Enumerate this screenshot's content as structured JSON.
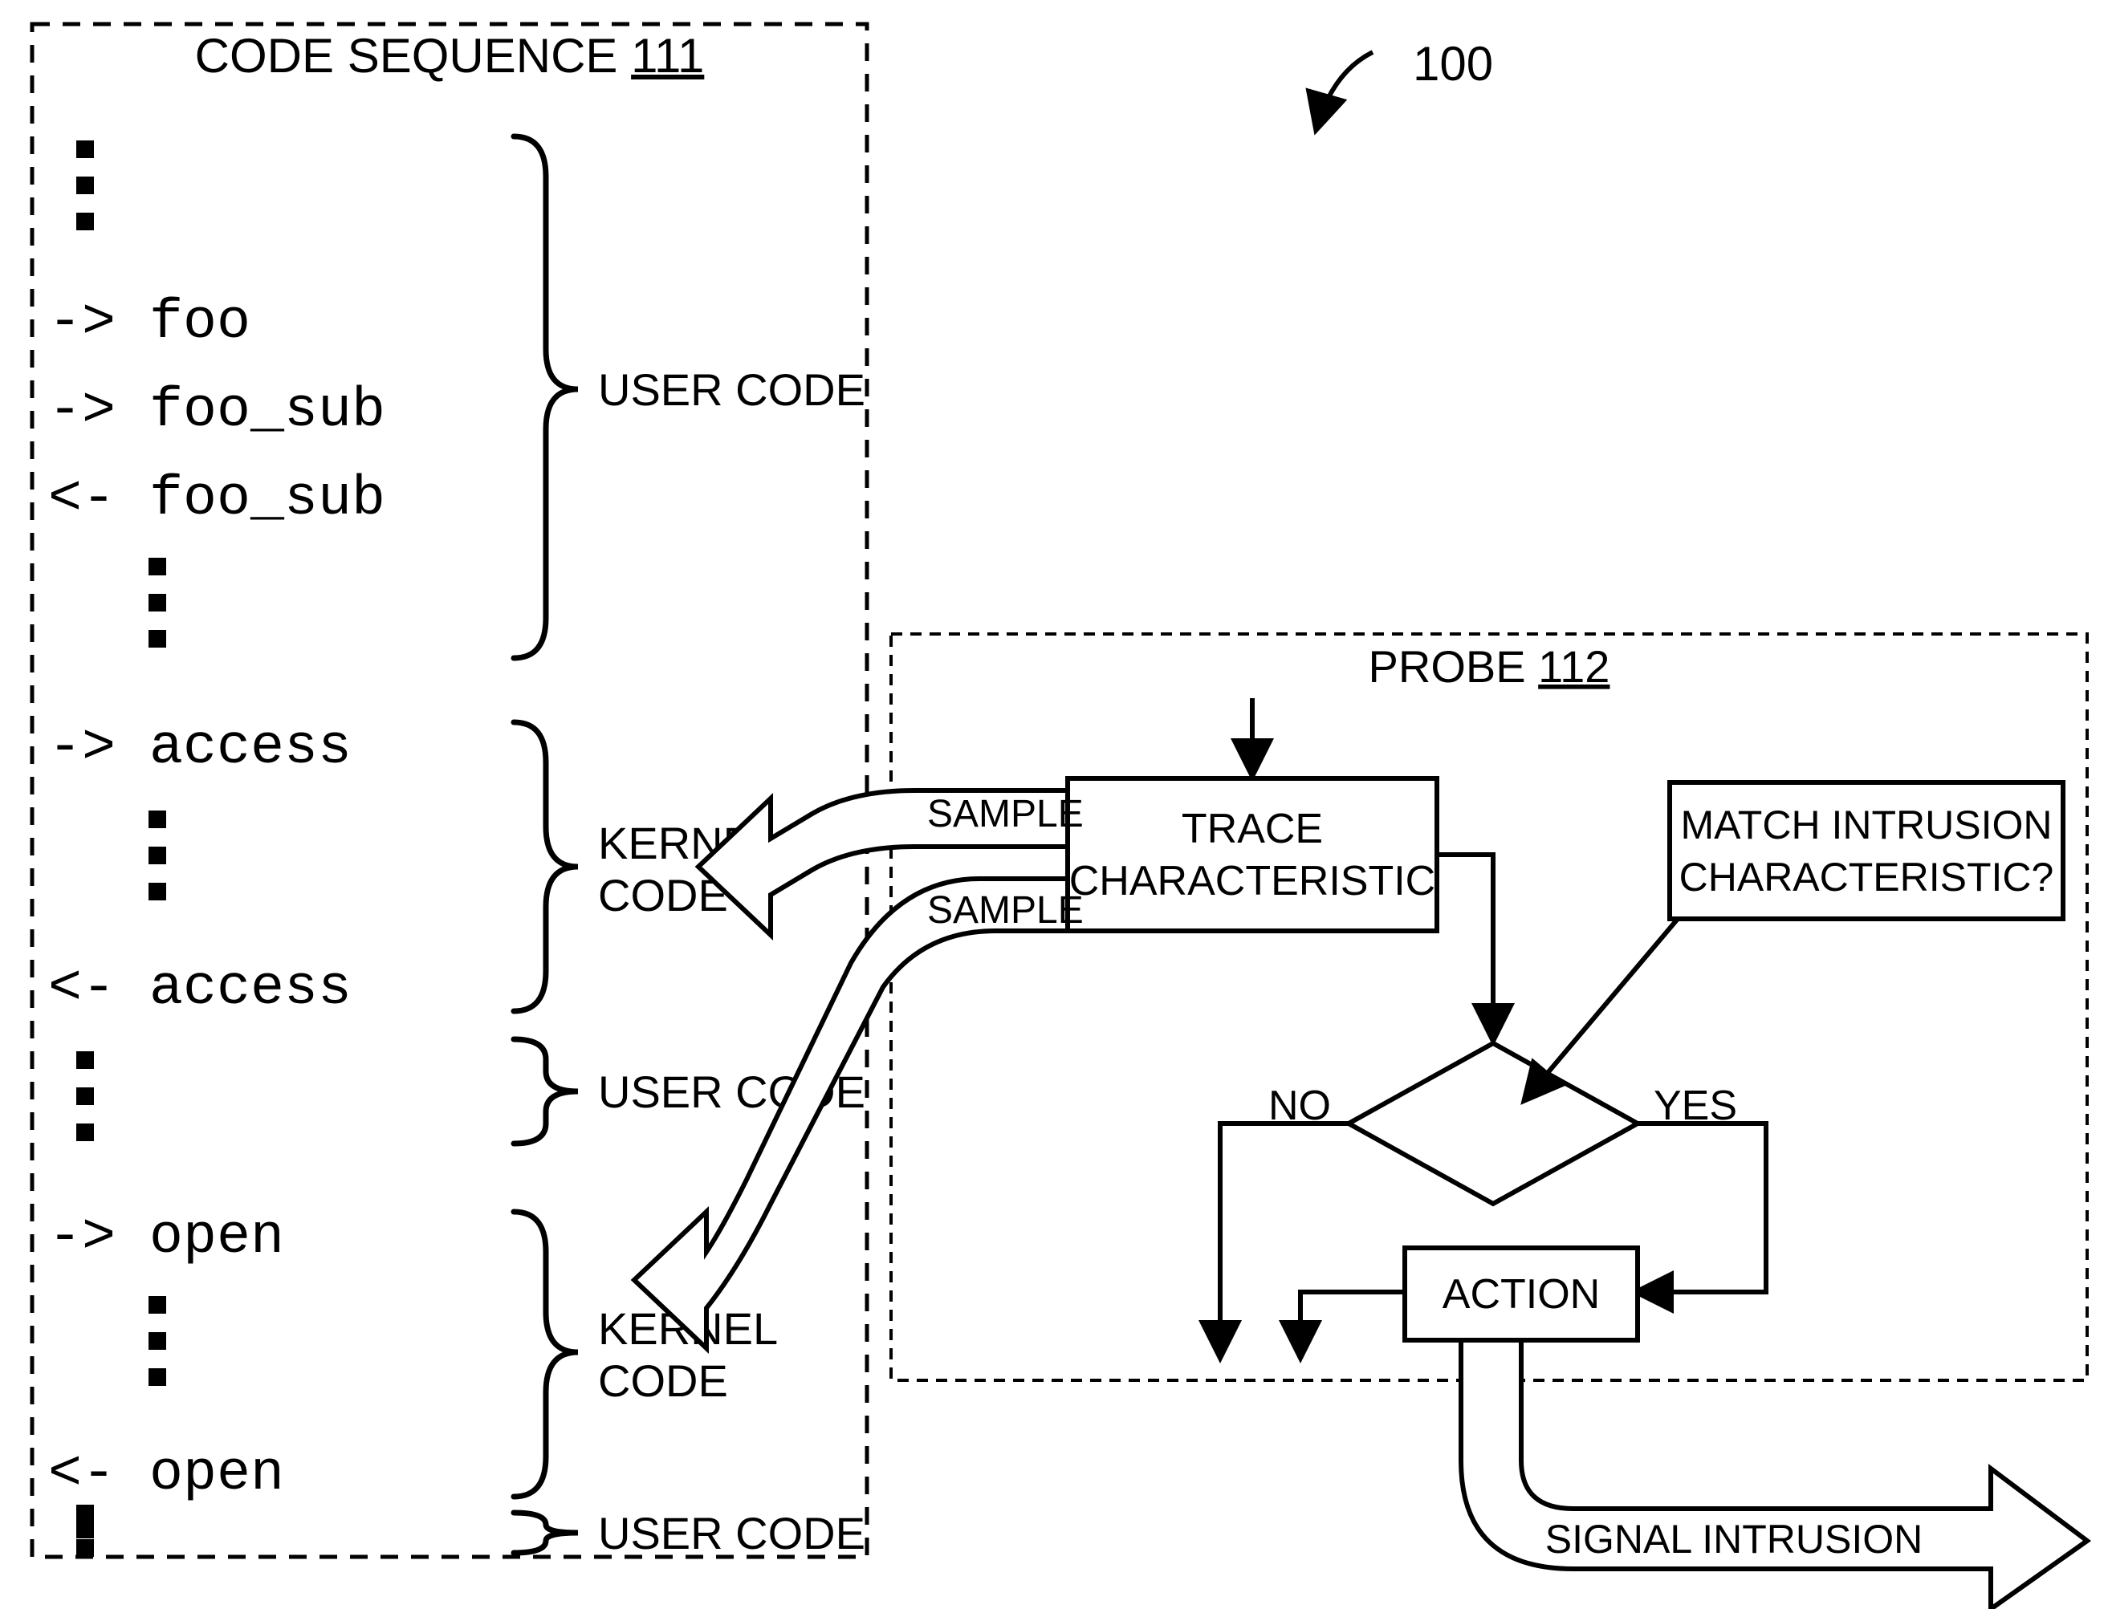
{
  "figure_ref": "100",
  "code_sequence": {
    "title": "CODE SEQUENCE",
    "id": "111",
    "lines": [
      "-> foo",
      "   -> foo_sub",
      "   <- foo_sub",
      "   -> access",
      "   <- access",
      "   -> open",
      "   <- open"
    ],
    "section_labels": {
      "user_code": "USER CODE",
      "kernel_code": "KERNEL CODE"
    }
  },
  "probe": {
    "title": "PROBE",
    "id": "112",
    "sample_label": "SAMPLE",
    "trace_box": "TRACE CHARACTERISTIC",
    "decision": "MATCH INTRUSION CHARACTERISTIC?",
    "no_label": "NO",
    "yes_label": "YES",
    "action_box": "ACTION",
    "signal_intrusion": "SIGNAL INTRUSION"
  }
}
